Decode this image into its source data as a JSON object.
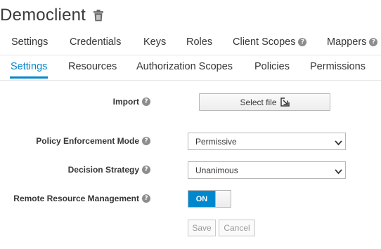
{
  "header": {
    "title": "Democlient",
    "delete_icon": "trash-icon"
  },
  "client_tabs": [
    {
      "label": "Settings",
      "help": false
    },
    {
      "label": "Credentials",
      "help": false
    },
    {
      "label": "Keys",
      "help": false
    },
    {
      "label": "Roles",
      "help": false
    },
    {
      "label": "Client Scopes",
      "help": true
    },
    {
      "label": "Mappers",
      "help": true
    }
  ],
  "authz_tabs": [
    {
      "label": "Settings",
      "active": true
    },
    {
      "label": "Resources",
      "active": false
    },
    {
      "label": "Authorization Scopes",
      "active": false
    },
    {
      "label": "Policies",
      "active": false
    },
    {
      "label": "Permissions",
      "active": false
    }
  ],
  "form": {
    "import": {
      "label": "Import",
      "button_label": "Select file",
      "button_icon": "import-file-icon"
    },
    "policy_enforcement": {
      "label": "Policy Enforcement Mode",
      "value": "Permissive"
    },
    "decision_strategy": {
      "label": "Decision Strategy",
      "value": "Unanimous"
    },
    "remote_resource": {
      "label": "Remote Resource Management",
      "toggle_label": "ON",
      "enabled": true
    },
    "save_label": "Save",
    "cancel_label": "Cancel"
  },
  "help_glyph": "?",
  "colors": {
    "accent": "#0088ce",
    "text": "#363636",
    "help_icon": "#8b8d8f"
  }
}
